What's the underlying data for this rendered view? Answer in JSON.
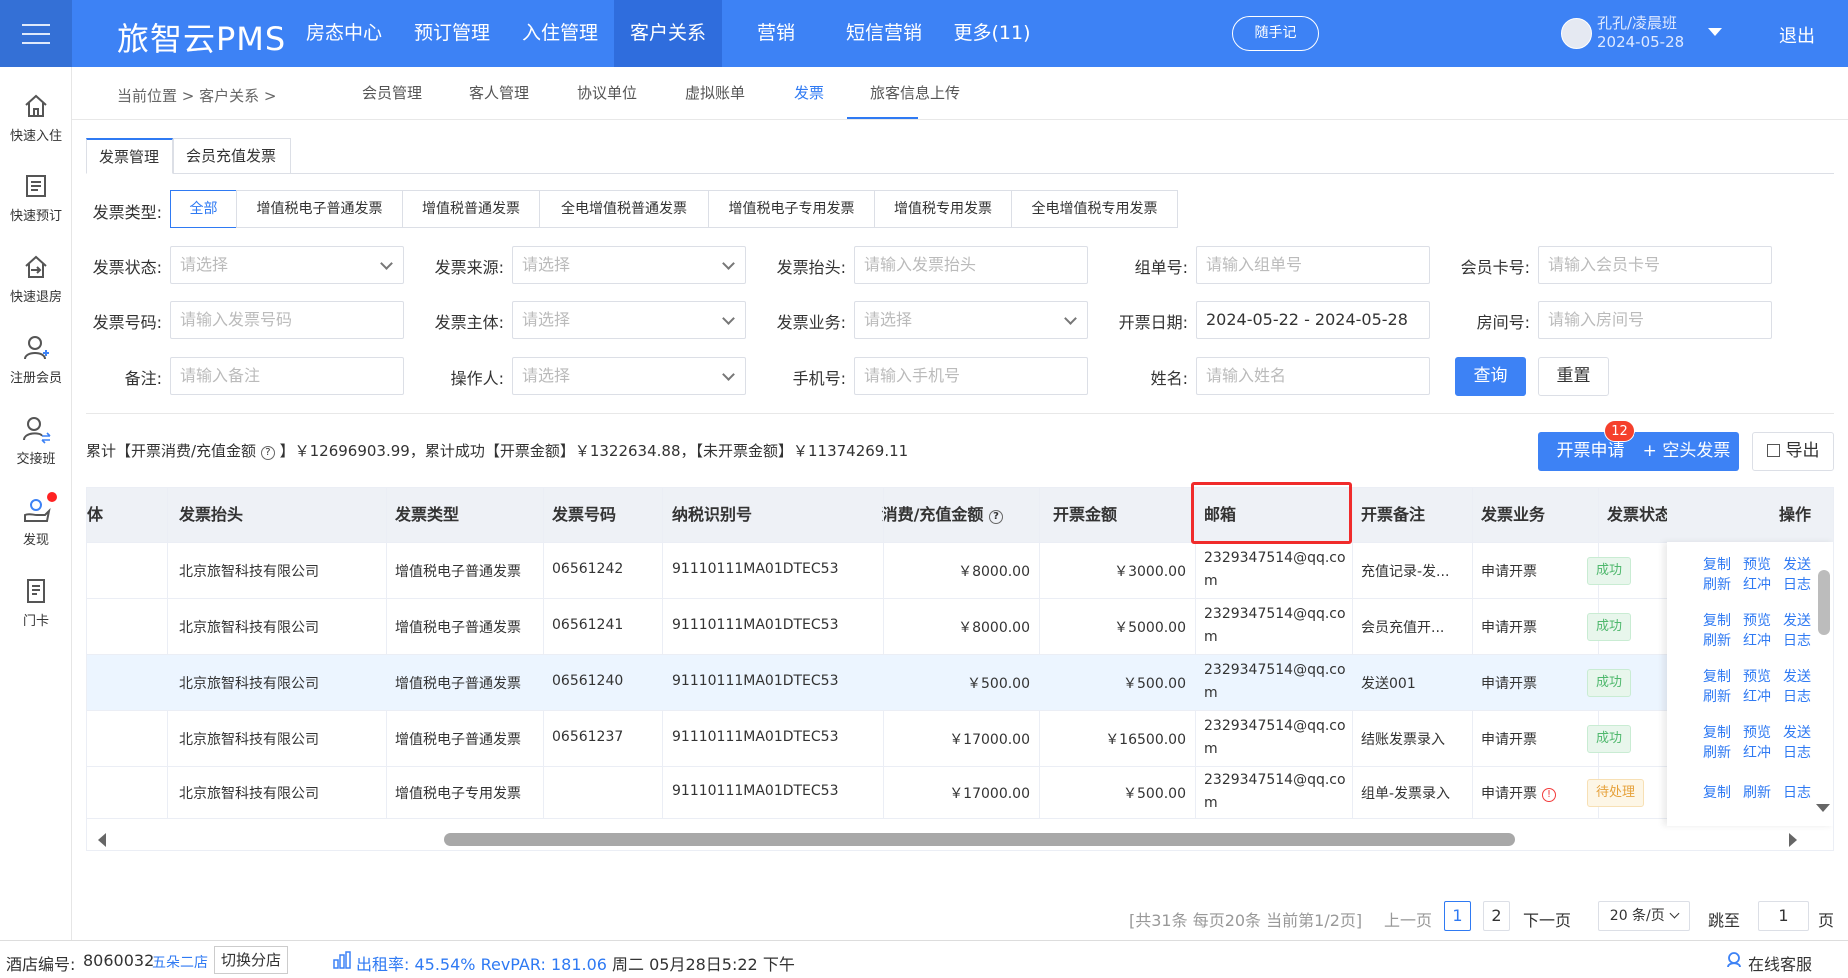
{
  "header": {
    "brand": "旅智云PMS",
    "nav": [
      "房态中心",
      "预订管理",
      "入住管理",
      "客户关系",
      "营销",
      "短信营销",
      "更多(11)"
    ],
    "memo": "随手记",
    "user_name": "孔孔/凌晨班",
    "user_date": "2024-05-28",
    "logout": "退出"
  },
  "sidebar": {
    "items": [
      "快速入住",
      "快速预订",
      "快速退房",
      "注册会员",
      "交接班",
      "发现",
      "门卡"
    ]
  },
  "breadcrumb": {
    "text": "当前位置 > 客户关系 >",
    "subnav": [
      "会员管理",
      "客人管理",
      "协议单位",
      "虚拟账单",
      "发票",
      "旅客信息上传"
    ]
  },
  "tabs": [
    "发票管理",
    "会员充值发票"
  ],
  "filters": {
    "type_label": "发票类型:",
    "types": [
      "全部",
      "增值税电子普通发票",
      "增值税普通发票",
      "全电增值税普通发票",
      "增值税电子专用发票",
      "增值税专用发票",
      "全电增值税专用发票"
    ],
    "labels": {
      "status": "发票状态:",
      "source": "发票来源:",
      "title": "发票抬头:",
      "group": "组单号:",
      "card": "会员卡号:",
      "number": "发票号码:",
      "subject": "发票主体:",
      "business": "发票业务:",
      "date": "开票日期:",
      "room": "房间号:",
      "remark": "备注:",
      "operator": "操作人:",
      "phone": "手机号:",
      "name": "姓名:"
    },
    "placeholders": {
      "select": "请选择",
      "title": "请输入发票抬头",
      "group": "请输入组单号",
      "card": "请输入会员卡号",
      "number": "请输入发票号码",
      "room": "请输入房间号",
      "remark": "请输入备注",
      "phone": "请输入手机号",
      "name": "请输入姓名"
    },
    "date_value": "2024-05-22 - 2024-05-28",
    "query": "查询",
    "reset": "重置"
  },
  "summary": {
    "part1": "累计【开票消费/充值金额",
    "part2": "】￥12696903.99，累计成功【开票金额】￥1322634.88，【未开票金额】￥11374269.11"
  },
  "actions": {
    "apply": "开票申请",
    "apply_badge": "12",
    "blank": "+ 空头发票",
    "export": "导出"
  },
  "table": {
    "headers": [
      "体",
      "发票抬头",
      "发票类型",
      "发票号码",
      "纳税识别号",
      "消费/充值金额",
      "开票金额",
      "邮箱",
      "开票备注",
      "发票业务",
      "发票状态",
      "操作"
    ],
    "rows": [
      {
        "title": "北京旅智科技有限公司",
        "type": "增值税电子普通发票",
        "number": "06561242",
        "tax": "91110111MA01DTEC53",
        "consume": "￥8000.00",
        "amount": "￥3000.00",
        "email": "2329347514@qq.com",
        "remark": "充值记录-发...",
        "business": "申请开票",
        "status": "成功",
        "ops": [
          "复制",
          "预览",
          "发送",
          "刷新",
          "红冲",
          "日志"
        ]
      },
      {
        "title": "北京旅智科技有限公司",
        "type": "增值税电子普通发票",
        "number": "06561241",
        "tax": "91110111MA01DTEC53",
        "consume": "￥8000.00",
        "amount": "￥5000.00",
        "email": "2329347514@qq.com",
        "remark": "会员充值开...",
        "business": "申请开票",
        "status": "成功",
        "ops": [
          "复制",
          "预览",
          "发送",
          "刷新",
          "红冲",
          "日志"
        ]
      },
      {
        "title": "北京旅智科技有限公司",
        "type": "增值税电子普通发票",
        "number": "06561240",
        "tax": "91110111MA01DTEC53",
        "consume": "￥500.00",
        "amount": "￥500.00",
        "email": "2329347514@qq.com",
        "remark": "发送001",
        "business": "申请开票",
        "status": "成功",
        "ops": [
          "复制",
          "预览",
          "发送",
          "刷新",
          "红冲",
          "日志"
        ]
      },
      {
        "title": "北京旅智科技有限公司",
        "type": "增值税电子普通发票",
        "number": "06561237",
        "tax": "91110111MA01DTEC53",
        "consume": "￥17000.00",
        "amount": "￥16500.00",
        "email": "2329347514@qq.com",
        "remark": "结账发票录入",
        "business": "申请开票",
        "status": "成功",
        "ops": [
          "复制",
          "预览",
          "发送",
          "刷新",
          "红冲",
          "日志"
        ]
      },
      {
        "title": "北京旅智科技有限公司",
        "type": "增值税电子专用发票",
        "number": "",
        "tax": "91110111MA01DTEC53",
        "consume": "￥17000.00",
        "amount": "￥500.00",
        "email": "2329347514@qq.com",
        "remark": "组单-发票录入",
        "business": "申请开票",
        "status": "待处理",
        "ops": [
          "复制",
          "刷新",
          "日志"
        ]
      }
    ]
  },
  "pagination": {
    "info": "[共31条 每页20条 当前第1/2页]",
    "prev": "上一页",
    "pages": [
      "1",
      "2"
    ],
    "next": "下一页",
    "size": "20 条/页",
    "jump": "跳至",
    "jump_value": "1",
    "page_unit": "页"
  },
  "statusbar": {
    "hotel_label": "酒店编号:",
    "hotel_no": "8060032",
    "branch": "五朵二店",
    "switch": "切换分店",
    "occupancy": "出租率: 45.54% RevPAR: 181.06",
    "datetime": "周二 05月28日5:22 下午",
    "service": "在线客服"
  },
  "colors": {
    "primary": "#3d82f5",
    "highlight_box": "#f02b2b",
    "success": "#4fb86d",
    "pending": "#e6a23c"
  }
}
